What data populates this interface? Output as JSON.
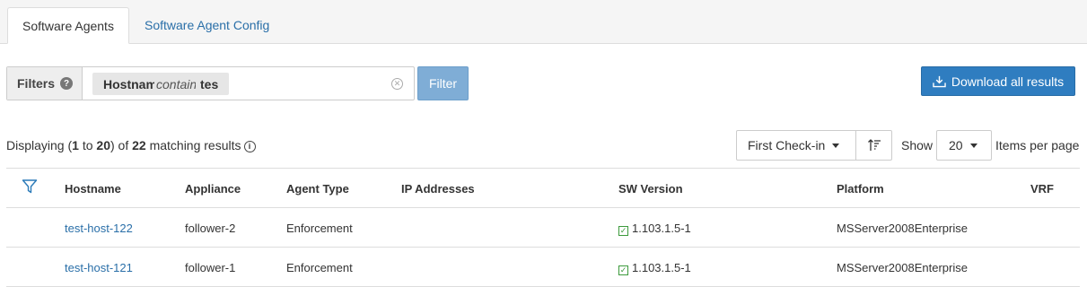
{
  "tabs": [
    {
      "label": "Software Agents",
      "active": true
    },
    {
      "label": "Software Agent Config",
      "active": false
    }
  ],
  "filters": {
    "label": "Filters",
    "chip": {
      "field": "Hostname",
      "operator": "contains",
      "value": "tes"
    },
    "filter_button": "Filter"
  },
  "download_button": "Download all results",
  "results": {
    "prefix": "Displaying (",
    "from": "1",
    "to_word": " to ",
    "to": "20",
    "mid": ") of ",
    "total": "22",
    "suffix": " matching results"
  },
  "sort": {
    "selected": "First Check-in"
  },
  "paging": {
    "show_label": "Show",
    "page_size": "20",
    "per_page_label": "Items per page"
  },
  "table": {
    "columns": [
      "Hostname",
      "Appliance",
      "Agent Type",
      "IP Addresses",
      "SW Version",
      "Platform",
      "VRF"
    ],
    "rows": [
      {
        "hostname": "test-host-122",
        "appliance": "follower-2",
        "agent_type": "Enforcement",
        "ip": "",
        "sw_version": "1.103.1.5-1",
        "platform": "MSServer2008Enterprise",
        "vrf": ""
      },
      {
        "hostname": "test-host-121",
        "appliance": "follower-1",
        "agent_type": "Enforcement",
        "ip": "",
        "sw_version": "1.103.1.5-1",
        "platform": "MSServer2008Enterprise",
        "vrf": ""
      }
    ]
  },
  "colors": {
    "link": "#2a6fa8",
    "primary_button": "#2f7dc0",
    "filter_button": "#7fadd6",
    "check": "#3c9a3c"
  }
}
